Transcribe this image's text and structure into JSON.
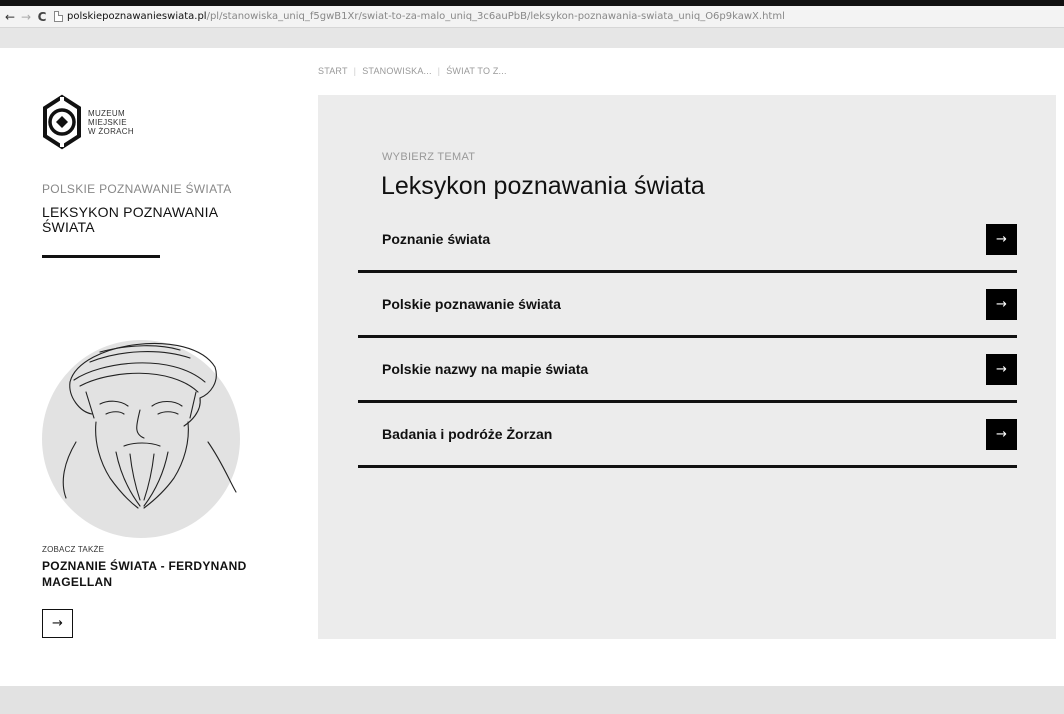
{
  "browser": {
    "back_icon": "←",
    "forward_icon": "→",
    "reload_icon": "C",
    "url_domain": "polskiepoznawanieswiata.pl",
    "url_path": "/pl/stanowiska_uniq_f5gwB1Xr/swiat-to-za-malo_uniq_3c6auPbB/leksykon-poznawania-swiata_uniq_O6p9kawX.html"
  },
  "breadcrumb": {
    "items": [
      "START",
      "STANOWISKA...",
      "ŚWIAT TO Z..."
    ],
    "separator": "|"
  },
  "logo": {
    "line1": "MUZEUM",
    "line2": "MIEJSKIE",
    "line3": "W ŻORACH"
  },
  "sidebar": {
    "section": "POLSKIE POZNAWANIE ŚWIATA",
    "title": "LEKSYKON POZNAWANIA ŚWIATA",
    "see_also_label": "ZOBACZ TAKŻE",
    "see_also_title": "POZNANIE ŚWIATA - FERDYNAND MAGELLAN",
    "see_also_arrow": "→"
  },
  "main": {
    "choose_label": "WYBIERZ TEMAT",
    "heading": "Leksykon poznawania świata",
    "topics": [
      {
        "label": "Poznanie świata",
        "arrow": "→"
      },
      {
        "label": "Polskie poznawanie świata",
        "arrow": "→"
      },
      {
        "label": "Polskie nazwy na mapie świata",
        "arrow": "→"
      },
      {
        "label": "Badania i podróże Żorzan",
        "arrow": "→"
      }
    ]
  },
  "colors": {
    "panel_bg": "#ececec",
    "accent": "#111111",
    "muted_text": "#999999"
  }
}
